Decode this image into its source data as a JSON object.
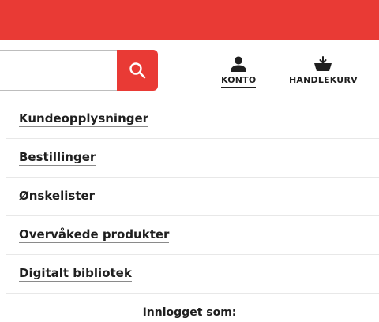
{
  "header": {
    "brand_color": "#e93a35",
    "search": {
      "value": "",
      "placeholder": "",
      "icon": "search-icon"
    },
    "account": {
      "label": "KONTO",
      "icon": "person-icon"
    },
    "cart": {
      "label": "HANDLEKURV",
      "icon": "basket-icon"
    }
  },
  "menu": {
    "items": [
      {
        "label": "Kundeopplysninger"
      },
      {
        "label": "Bestillinger"
      },
      {
        "label": "Ønskelister"
      },
      {
        "label": "Overvåkede produkter"
      },
      {
        "label": "Digitalt bibliotek"
      }
    ]
  },
  "footer": {
    "logged_in_label": "Innlogget som:"
  }
}
